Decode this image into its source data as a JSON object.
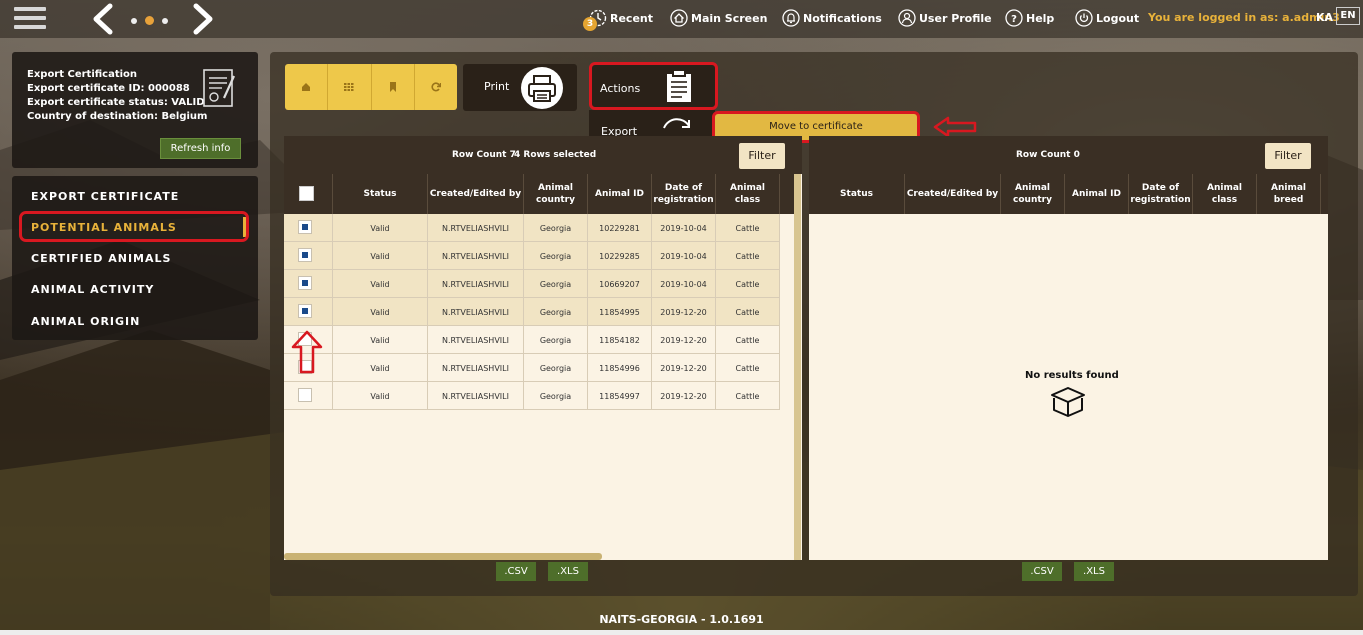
{
  "topbar": {
    "recent_label": "Recent",
    "recent_badge": "3",
    "main_screen_label": "Main Screen",
    "notifications_label": "Notifications",
    "user_profile_label": "User Profile",
    "help_label": "Help",
    "logout_label": "Logout",
    "logged_in_text": "You are logged in as: a.admin3",
    "lang_ka": "KA",
    "lang_en": "EN"
  },
  "info": {
    "line1": "Export Certification",
    "line2": "Export certificate ID: 000088",
    "line3": "Export certificate status: VALID",
    "line4": "Country of destination: Belgium",
    "refresh_label": "Refresh info"
  },
  "menu": {
    "items": [
      {
        "label": "EXPORT CERTIFICATE"
      },
      {
        "label": "POTENTIAL ANIMALS"
      },
      {
        "label": "CERTIFIED ANIMALS"
      },
      {
        "label": "ANIMAL ACTIVITY"
      },
      {
        "label": "ANIMAL ORIGIN"
      }
    ]
  },
  "toolbar": {
    "print_label": "Print",
    "actions_label": "Actions",
    "export_label": "Export",
    "move_label": "Move to certificate"
  },
  "left_grid": {
    "row_count_text": "Row Count 7",
    "selected_text": "4 Rows selected",
    "filter_label": "Filter",
    "columns": [
      "Status",
      "Created/Edited by",
      "Animal country",
      "Animal ID",
      "Date of registration",
      "Animal class"
    ],
    "rows": [
      {
        "selected": true,
        "status": "Valid",
        "created": "N.RTVELIASHVILI",
        "country": "Georgia",
        "id": "10229281",
        "date": "2019-10-04",
        "class": "Cattle"
      },
      {
        "selected": true,
        "status": "Valid",
        "created": "N.RTVELIASHVILI",
        "country": "Georgia",
        "id": "10229285",
        "date": "2019-10-04",
        "class": "Cattle"
      },
      {
        "selected": true,
        "status": "Valid",
        "created": "N.RTVELIASHVILI",
        "country": "Georgia",
        "id": "10669207",
        "date": "2019-10-04",
        "class": "Cattle"
      },
      {
        "selected": true,
        "status": "Valid",
        "created": "N.RTVELIASHVILI",
        "country": "Georgia",
        "id": "11854995",
        "date": "2019-12-20",
        "class": "Cattle"
      },
      {
        "selected": false,
        "status": "Valid",
        "created": "N.RTVELIASHVILI",
        "country": "Georgia",
        "id": "11854182",
        "date": "2019-12-20",
        "class": "Cattle"
      },
      {
        "selected": false,
        "status": "Valid",
        "created": "N.RTVELIASHVILI",
        "country": "Georgia",
        "id": "11854996",
        "date": "2019-12-20",
        "class": "Cattle"
      },
      {
        "selected": false,
        "status": "Valid",
        "created": "N.RTVELIASHVILI",
        "country": "Georgia",
        "id": "11854997",
        "date": "2019-12-20",
        "class": "Cattle"
      }
    ]
  },
  "right_grid": {
    "row_count_text": "Row Count 0",
    "filter_label": "Filter",
    "columns": [
      "Status",
      "Created/Edited by",
      "Animal country",
      "Animal ID",
      "Date of registration",
      "Animal class",
      "Animal breed"
    ],
    "empty_text": "No results found"
  },
  "exports": {
    "csv": ".CSV",
    "xls": ".XLS"
  },
  "footer": {
    "version": "NAITS-GEORGIA - 1.0.1691"
  },
  "colors": {
    "accent": "#e8b23a",
    "highlight_red": "#d81820",
    "export_green": "#4e6e2a"
  }
}
